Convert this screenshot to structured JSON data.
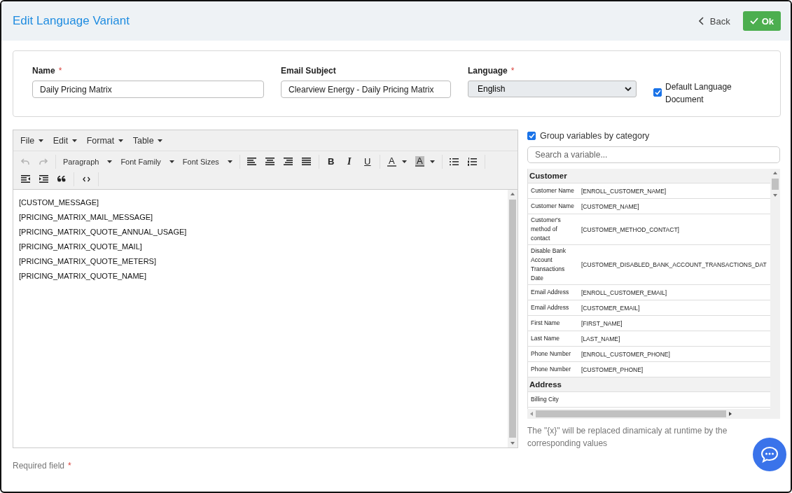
{
  "header": {
    "title": "Edit Language Variant",
    "back": "Back",
    "ok": "Ok"
  },
  "required_mark": "*",
  "form": {
    "name": {
      "label": "Name",
      "required": true,
      "value": "Daily Pricing Matrix"
    },
    "email_subject": {
      "label": "Email Subject",
      "required": false,
      "value": "Clearview Energy - Daily Pricing Matrix"
    },
    "language": {
      "label": "Language",
      "required": true,
      "value": "English"
    },
    "default_document": {
      "label": "Default Language Document",
      "checked": true
    }
  },
  "editor": {
    "menus": [
      "File",
      "Edit",
      "Format",
      "Table"
    ],
    "toolbar_rows": [
      [
        [
          {
            "kind": "undo",
            "disabled": true
          },
          {
            "kind": "redo",
            "disabled": true
          }
        ],
        [
          {
            "kind": "select",
            "label": "Paragraph"
          },
          {
            "kind": "select",
            "label": "Font Family"
          },
          {
            "kind": "select",
            "label": "Font Sizes"
          }
        ],
        [
          {
            "kind": "align-left"
          },
          {
            "kind": "align-center"
          },
          {
            "kind": "align-right"
          },
          {
            "kind": "justify"
          }
        ],
        [
          {
            "kind": "bold",
            "glyph": "B"
          },
          {
            "kind": "italic",
            "glyph": "I"
          },
          {
            "kind": "underline",
            "glyph": "U"
          }
        ],
        [
          {
            "kind": "text-color",
            "glyph": "A"
          },
          {
            "kind": "highlight",
            "glyph": "A"
          }
        ],
        [
          {
            "kind": "bullet-list"
          },
          {
            "kind": "numbered-list"
          }
        ]
      ],
      [
        [
          {
            "kind": "outdent"
          },
          {
            "kind": "indent"
          },
          {
            "kind": "quote"
          }
        ],
        [
          {
            "kind": "code"
          }
        ]
      ]
    ],
    "lines": [
      "[CUSTOM_MESSAGE]",
      "[PRICING_MATRIX_MAIL_MESSAGE]",
      "[PRICING_MATRIX_QUOTE_ANNUAL_USAGE]",
      "[PRICING_MATRIX_QUOTE_MAIL]",
      "[PRICING_MATRIX_QUOTE_METERS]",
      "[PRICING_MATRIX_QUOTE_NAME]"
    ]
  },
  "variables": {
    "group_by": {
      "label": "Group variables by category",
      "checked": true
    },
    "search": {
      "placeholder": "Search a variable..."
    },
    "groups": [
      {
        "name": "Customer",
        "rows": [
          {
            "label": "Customer Name",
            "value": "[ENROLL_CUSTOMER_NAME]"
          },
          {
            "label": "Customer Name",
            "value": "[CUSTOMER_NAME]"
          },
          {
            "label": "Customer's method of contact",
            "value": "[CUSTOMER_METHOD_CONTACT]"
          },
          {
            "label": "Disable Bank Account Transactions Date",
            "value": "[CUSTOMER_DISABLED_BANK_ACCOUNT_TRANSACTIONS_DAT"
          },
          {
            "label": "Email Address",
            "value": "[ENROLL_CUSTOMER_EMAIL]"
          },
          {
            "label": "Email Address",
            "value": "[CUSTOMER_EMAIL]"
          },
          {
            "label": "First Name",
            "value": "[FIRST_NAME]"
          },
          {
            "label": "Last Name",
            "value": "[LAST_NAME]"
          },
          {
            "label": "Phone Number",
            "value": "[ENROLL_CUSTOMER_PHONE]"
          },
          {
            "label": "Phone Number",
            "value": "[CUSTOMER_PHONE]"
          }
        ]
      },
      {
        "name": "Address",
        "rows": [
          {
            "label": "Billing City"
          }
        ]
      }
    ],
    "note": "The \"{x}\" will be replaced dinamicaly at runtime by the corresponding values"
  },
  "footer": {
    "required_note": "Required field"
  }
}
